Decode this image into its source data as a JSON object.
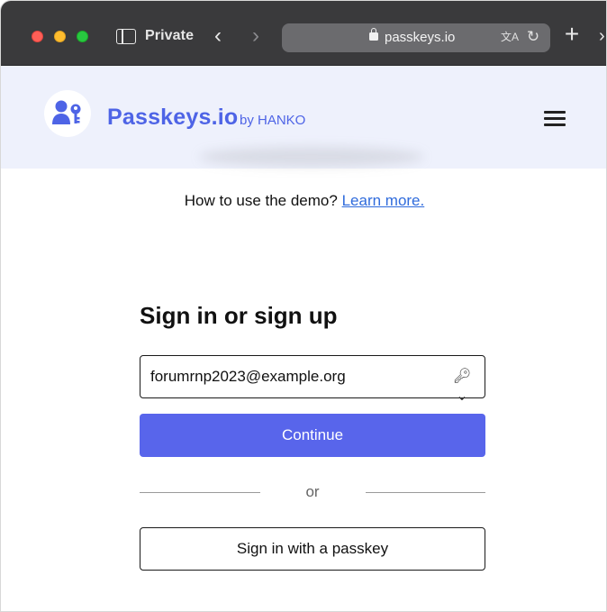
{
  "browser": {
    "mode_label": "Private",
    "url": "passkeys.io",
    "icons": {
      "sidebar": "sidebar-icon",
      "back": "chevron-left-icon",
      "forward": "chevron-right-icon",
      "lock": "lock-icon",
      "translate": "translate-icon",
      "reload": "reload-icon",
      "new_tab": "plus-icon",
      "tab_overview": "chevron-right-icon"
    },
    "glyphs": {
      "back": "‹",
      "forward": "›",
      "translate": "文A",
      "reload": "↻",
      "new_tab": "+",
      "tab_overview": "›"
    }
  },
  "site": {
    "brand_name": "Passkeys.io",
    "brand_by": "by HANKO",
    "logo_icon": "user-key-icon",
    "menu_icon": "hamburger-menu-icon",
    "brand_color": "#4e64e6"
  },
  "main": {
    "help_text": "How to use the demo?",
    "help_link": "Learn more.",
    "title": "Sign in or sign up",
    "email_value": "forumrnp2023@example.org",
    "key_glyph": "🔑︎⌄",
    "continue_label": "Continue",
    "divider_text": "or",
    "passkey_label": "Sign in with a passkey",
    "accent_color": "#5865eb"
  }
}
